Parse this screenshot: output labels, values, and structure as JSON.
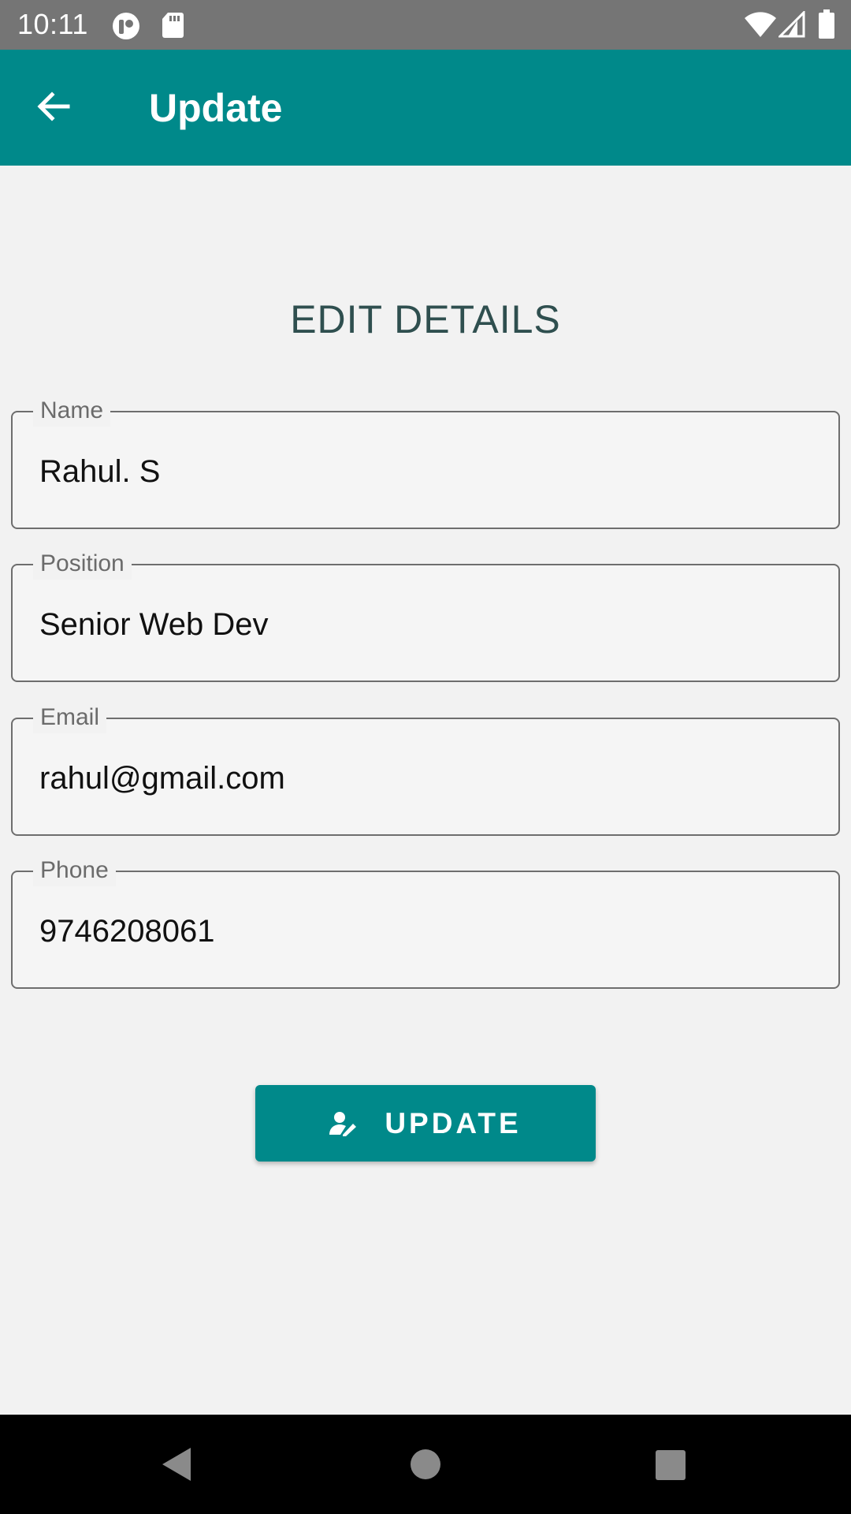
{
  "status_bar": {
    "time": "10:11",
    "icons": [
      "app-notification-icon",
      "sd-card-icon",
      "wifi-icon",
      "cellular-signal-icon",
      "battery-icon"
    ]
  },
  "app_bar": {
    "title": "Update",
    "back_icon": "arrow-left-icon",
    "color": "#00898a"
  },
  "form": {
    "heading": "EDIT DETAILS",
    "fields": [
      {
        "label": "Name",
        "value": "Rahul. S"
      },
      {
        "label": "Position",
        "value": "Senior Web Dev"
      },
      {
        "label": "Email",
        "value": "rahul@gmail.com"
      },
      {
        "label": "Phone",
        "value": "9746208061"
      }
    ],
    "submit": {
      "label": "UPDATE",
      "icon": "person-edit-icon"
    }
  },
  "nav_bar": {
    "icons": [
      "back-triangle-icon",
      "home-circle-icon",
      "recents-square-icon"
    ]
  },
  "colors": {
    "accent": "#00898a",
    "heading": "#2f4f4f",
    "status_bar": "#757575",
    "background": "#f2f2f2"
  }
}
